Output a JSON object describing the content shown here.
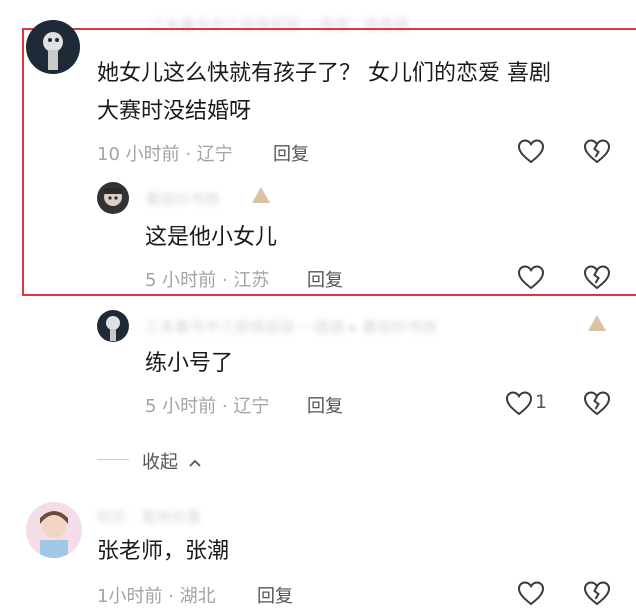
{
  "comments": [
    {
      "text_line1": "她女儿这么快就有孩子了？ 女儿们的恋爱 喜剧",
      "text_line2": "大赛时没结婚呀",
      "time_location": "10 小时前 · 辽宁",
      "reply_label": "回复",
      "replies": [
        {
          "text": "这是他小女儿",
          "time_location": "5 小时前 · 江苏",
          "reply_label": "回复"
        },
        {
          "text": "练小号了",
          "time_location": "5 小时前 · 辽宁",
          "reply_label": "回复",
          "like_count": "1"
        }
      ]
    },
    {
      "text": "张老师，张潮",
      "time_location": "1小时前 · 湖北",
      "reply_label": "回复"
    }
  ],
  "collapse_label": "收起",
  "colors": {
    "highlight": "#e2353a",
    "meta": "#a3a3a3"
  }
}
